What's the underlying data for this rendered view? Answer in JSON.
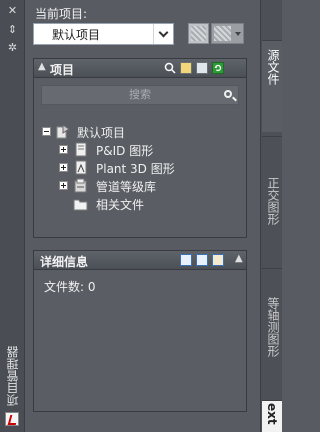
{
  "palette": {
    "title": "项目管理器"
  },
  "current": {
    "label": "当前项目:",
    "selected": "默认项目"
  },
  "project_panel": {
    "title": "项目",
    "search_placeholder": "搜索",
    "tree": {
      "root": "默认项目",
      "children": [
        "P&ID 图形",
        "Plant 3D 图形",
        "管道等级库",
        "相关文件"
      ]
    }
  },
  "details_panel": {
    "title": "详细信息",
    "file_count": "文件数: 0"
  },
  "tabs": [
    "源文件",
    "正交图形",
    "等轴测图形",
    "ext"
  ]
}
